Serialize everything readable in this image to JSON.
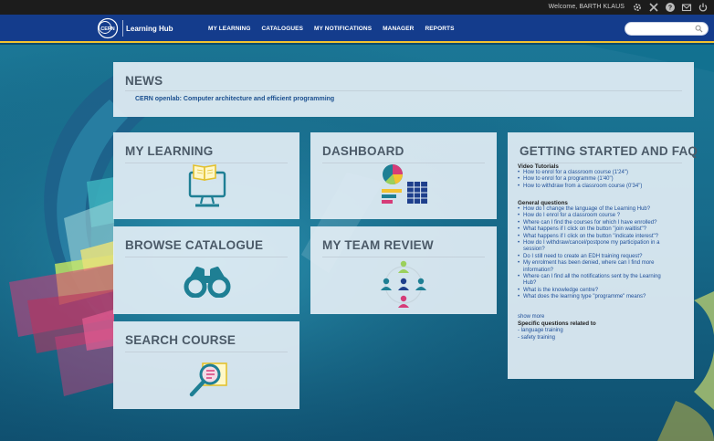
{
  "topbar": {
    "welcome": "Welcome, BARTH KLAUS"
  },
  "nav": {
    "brand": "Learning Hub",
    "logo_text": "CERN",
    "menu": [
      "MY LEARNING",
      "CATALOGUES",
      "MY NOTIFICATIONS",
      "MANAGER",
      "REPORTS"
    ],
    "search_placeholder": ""
  },
  "news": {
    "title": "NEWS",
    "link": "CERN openlab: Computer architecture and efficient programming"
  },
  "tiles": {
    "my_learning": "MY LEARNING",
    "dashboard": "DASHBOARD",
    "browse_catalogue": "BROWSE CATALOGUE",
    "my_team_review": "MY TEAM REVIEW",
    "search_course": "SEARCH COURSE"
  },
  "faq": {
    "title": "GETTING STARTED AND FAQ",
    "video_heading": "Video Tutorials",
    "video_items": [
      "How to enrol for a classroom course (1'24\")",
      "How to enrol for a programme (1'40\")",
      "How to withdraw from a classroom course (0'34\")"
    ],
    "general_heading": "General questions",
    "general_items": [
      "How do I change the language of the Learning Hub?",
      "How do I enrol for a classroom course ?",
      "Where can I find the courses for which I have enrolled?",
      "What happens if I click on the button \"join waitlist\"?",
      "What happens if I click on the button \"indicate interest\"?",
      "How do I withdraw/cancel/postpone my participation in a session?",
      "Do I still need to create an EDH training request?",
      "My enrolment has been denied, where can I find more information?",
      "Where can I find all the notifications sent by the Learning Hub?",
      "What is the knowledge centre?",
      "What does the learning type \"programme\" means?"
    ],
    "show_more": "show more",
    "specific_heading": "Specific questions related to",
    "specific_items": [
      "- language training",
      "- safety training"
    ]
  },
  "colors": {
    "nav_bg": "#143c8c",
    "accent_yellow": "#f2c230",
    "link_blue": "#1f4f99",
    "teal_icon": "#1e7f94",
    "pink": "#d63c78"
  }
}
